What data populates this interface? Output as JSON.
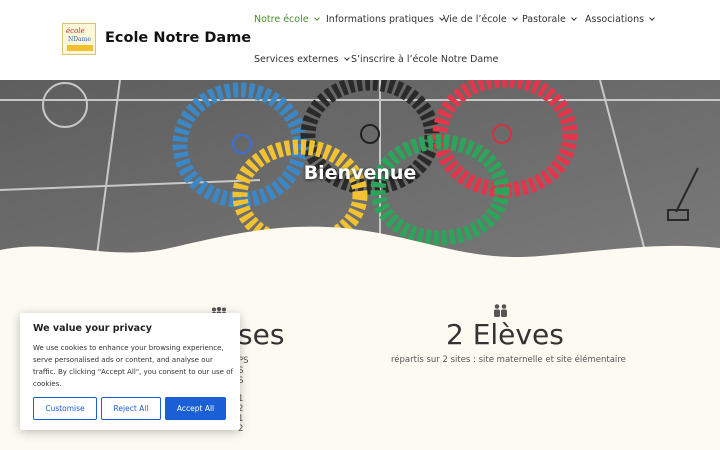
{
  "site": {
    "title": "Ecole Notre Dame",
    "logo_text_1": "école",
    "logo_text_2": "NDame"
  },
  "nav": {
    "items": [
      {
        "label": "Notre école",
        "dropdown": true,
        "active": true
      },
      {
        "label": "Informations pratiques",
        "dropdown": true
      },
      {
        "label": "Vie de l’école",
        "dropdown": true
      },
      {
        "label": "Pastorale",
        "dropdown": true
      },
      {
        "label": "Associations",
        "dropdown": true
      },
      {
        "label": "Services externes",
        "dropdown": true
      },
      {
        "label": "S’inscrire à l’école Notre Dame",
        "dropdown": false
      }
    ]
  },
  "hero": {
    "title": "Bienvenue"
  },
  "stats": {
    "classes": {
      "icon": "group-icon",
      "title_visible": "ses",
      "lines": [
        "PS",
        "S",
        "S",
        "1",
        "2",
        "1",
        "2"
      ]
    },
    "eleves": {
      "icon": "two-people-icon",
      "title": "2 Elèves",
      "subtitle": "répartis sur 2 sites : site maternelle et site élémentaire"
    }
  },
  "cookie": {
    "heading": "We value your privacy",
    "body": "We use cookies to enhance your browsing experience, serve personalised ads or content, and analyse our traffic. By clicking \"Accept All\", you consent to our use of cookies.",
    "buttons": {
      "customise": "Customise",
      "reject": "Reject All",
      "accept": "Accept All"
    }
  },
  "colors": {
    "accent_nav": "#4a8f2b",
    "button_blue": "#1a5fd6",
    "page_bg": "#fdfaf2"
  }
}
